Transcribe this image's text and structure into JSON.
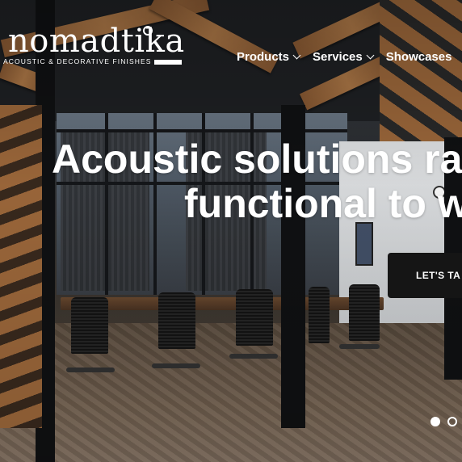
{
  "brand": {
    "name": "nomadtika",
    "tagline": "ACOUSTIC & DECORATIVE FINISHES"
  },
  "nav": {
    "items": [
      {
        "label": "Products",
        "has_dropdown": true
      },
      {
        "label": "Services",
        "has_dropdown": true
      },
      {
        "label": "Showcases",
        "has_dropdown": false
      }
    ]
  },
  "hero": {
    "headline_line1": "Acoustic solutions ra",
    "headline_line2": "functional to w",
    "cta_label": "LET'S TA"
  },
  "slider": {
    "slide_count_visible": 2,
    "active_index": 0
  },
  "colors": {
    "text": "#ffffff",
    "cta_background": "#151515",
    "wood_accent": "#a06a3c"
  },
  "icons": [
    "chevron-down-icon",
    "slide-dot-icon"
  ]
}
